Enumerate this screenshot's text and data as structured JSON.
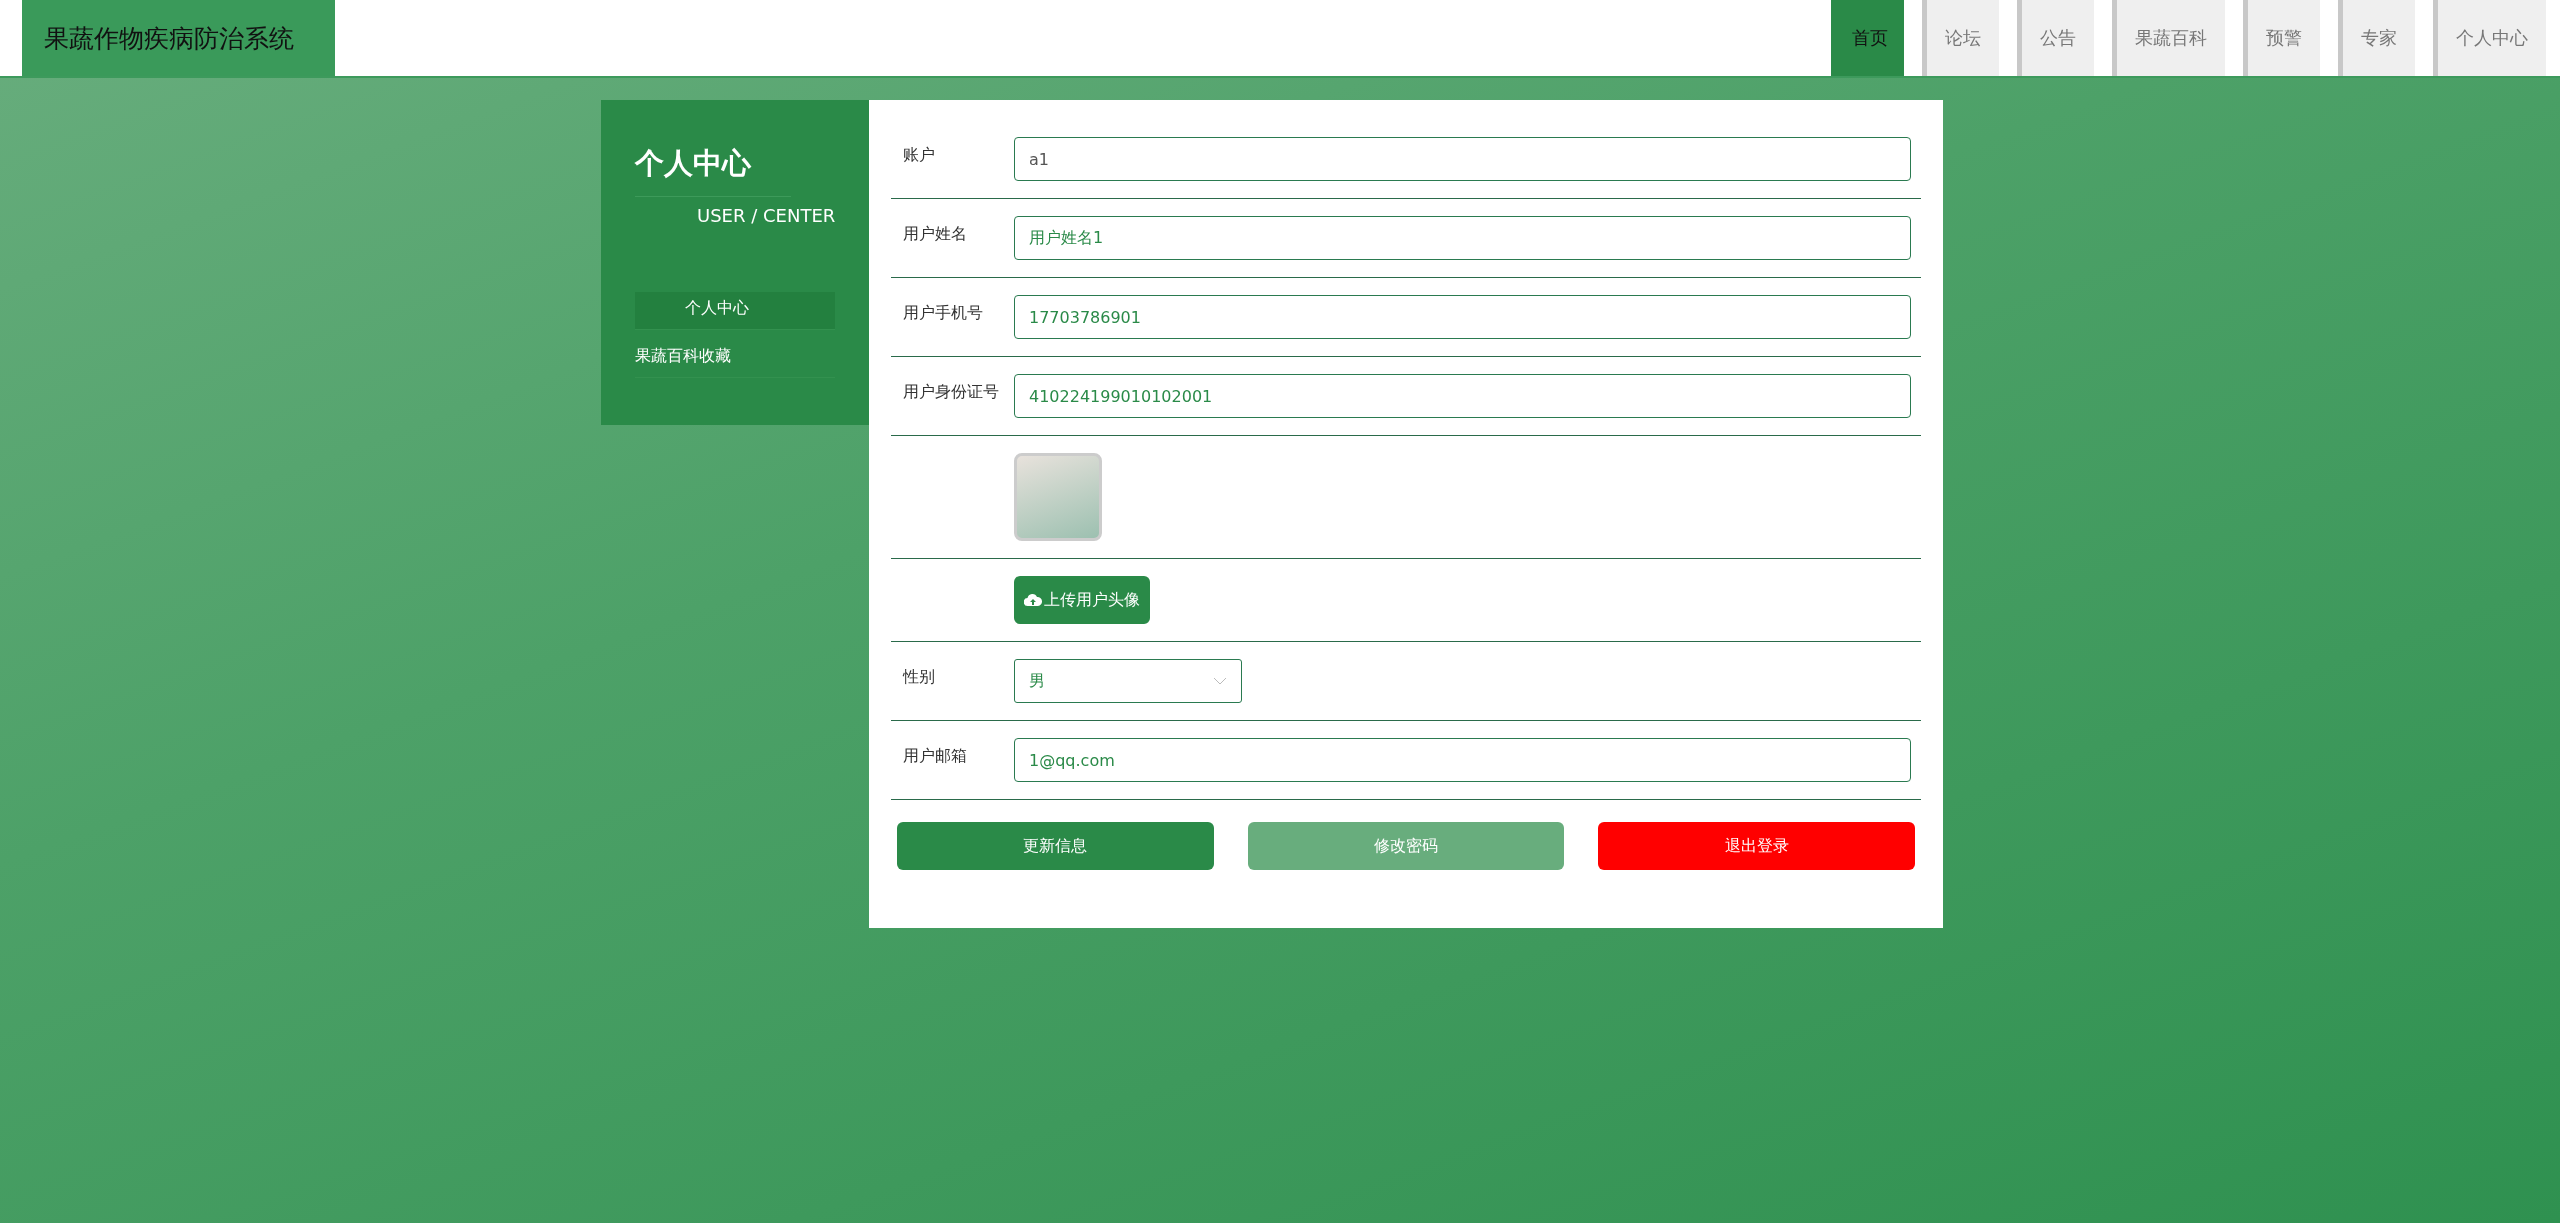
{
  "header": {
    "title": "果蔬作物疾病防治系统",
    "nav": [
      {
        "label": "首页",
        "selected": true
      },
      {
        "label": "论坛",
        "selected": false
      },
      {
        "label": "公告",
        "selected": false
      },
      {
        "label": "果蔬百科",
        "selected": false
      },
      {
        "label": "预警",
        "selected": false
      },
      {
        "label": "专家",
        "selected": false
      },
      {
        "label": "个人中心",
        "selected": false
      }
    ]
  },
  "sidebar": {
    "title": "个人中心",
    "subtitle": "USER / CENTER",
    "items": [
      {
        "label": "个人中心",
        "selected": true
      },
      {
        "label": "果蔬百科收藏",
        "selected": false
      }
    ]
  },
  "form": {
    "rows": [
      {
        "kind": "input",
        "label": "账户",
        "value": "a1",
        "disabled": true
      },
      {
        "kind": "input",
        "label": "用户姓名",
        "value": "用户姓名1",
        "disabled": false
      },
      {
        "kind": "input",
        "label": "用户手机号",
        "value": "17703786901",
        "disabled": false
      },
      {
        "kind": "input",
        "label": "用户身份证号",
        "value": "410224199010102001",
        "disabled": false
      },
      {
        "kind": "avatar"
      },
      {
        "kind": "upload",
        "button": "上传用户头像"
      },
      {
        "kind": "select",
        "label": "性别",
        "value": "男"
      },
      {
        "kind": "input",
        "label": "用户邮箱",
        "value": "1@qq.com",
        "disabled": false
      }
    ],
    "buttons": [
      {
        "label": "更新信息",
        "kind": "primary"
      },
      {
        "label": "修改密码",
        "kind": "secondary"
      },
      {
        "label": "退出登录",
        "kind": "danger"
      }
    ]
  }
}
